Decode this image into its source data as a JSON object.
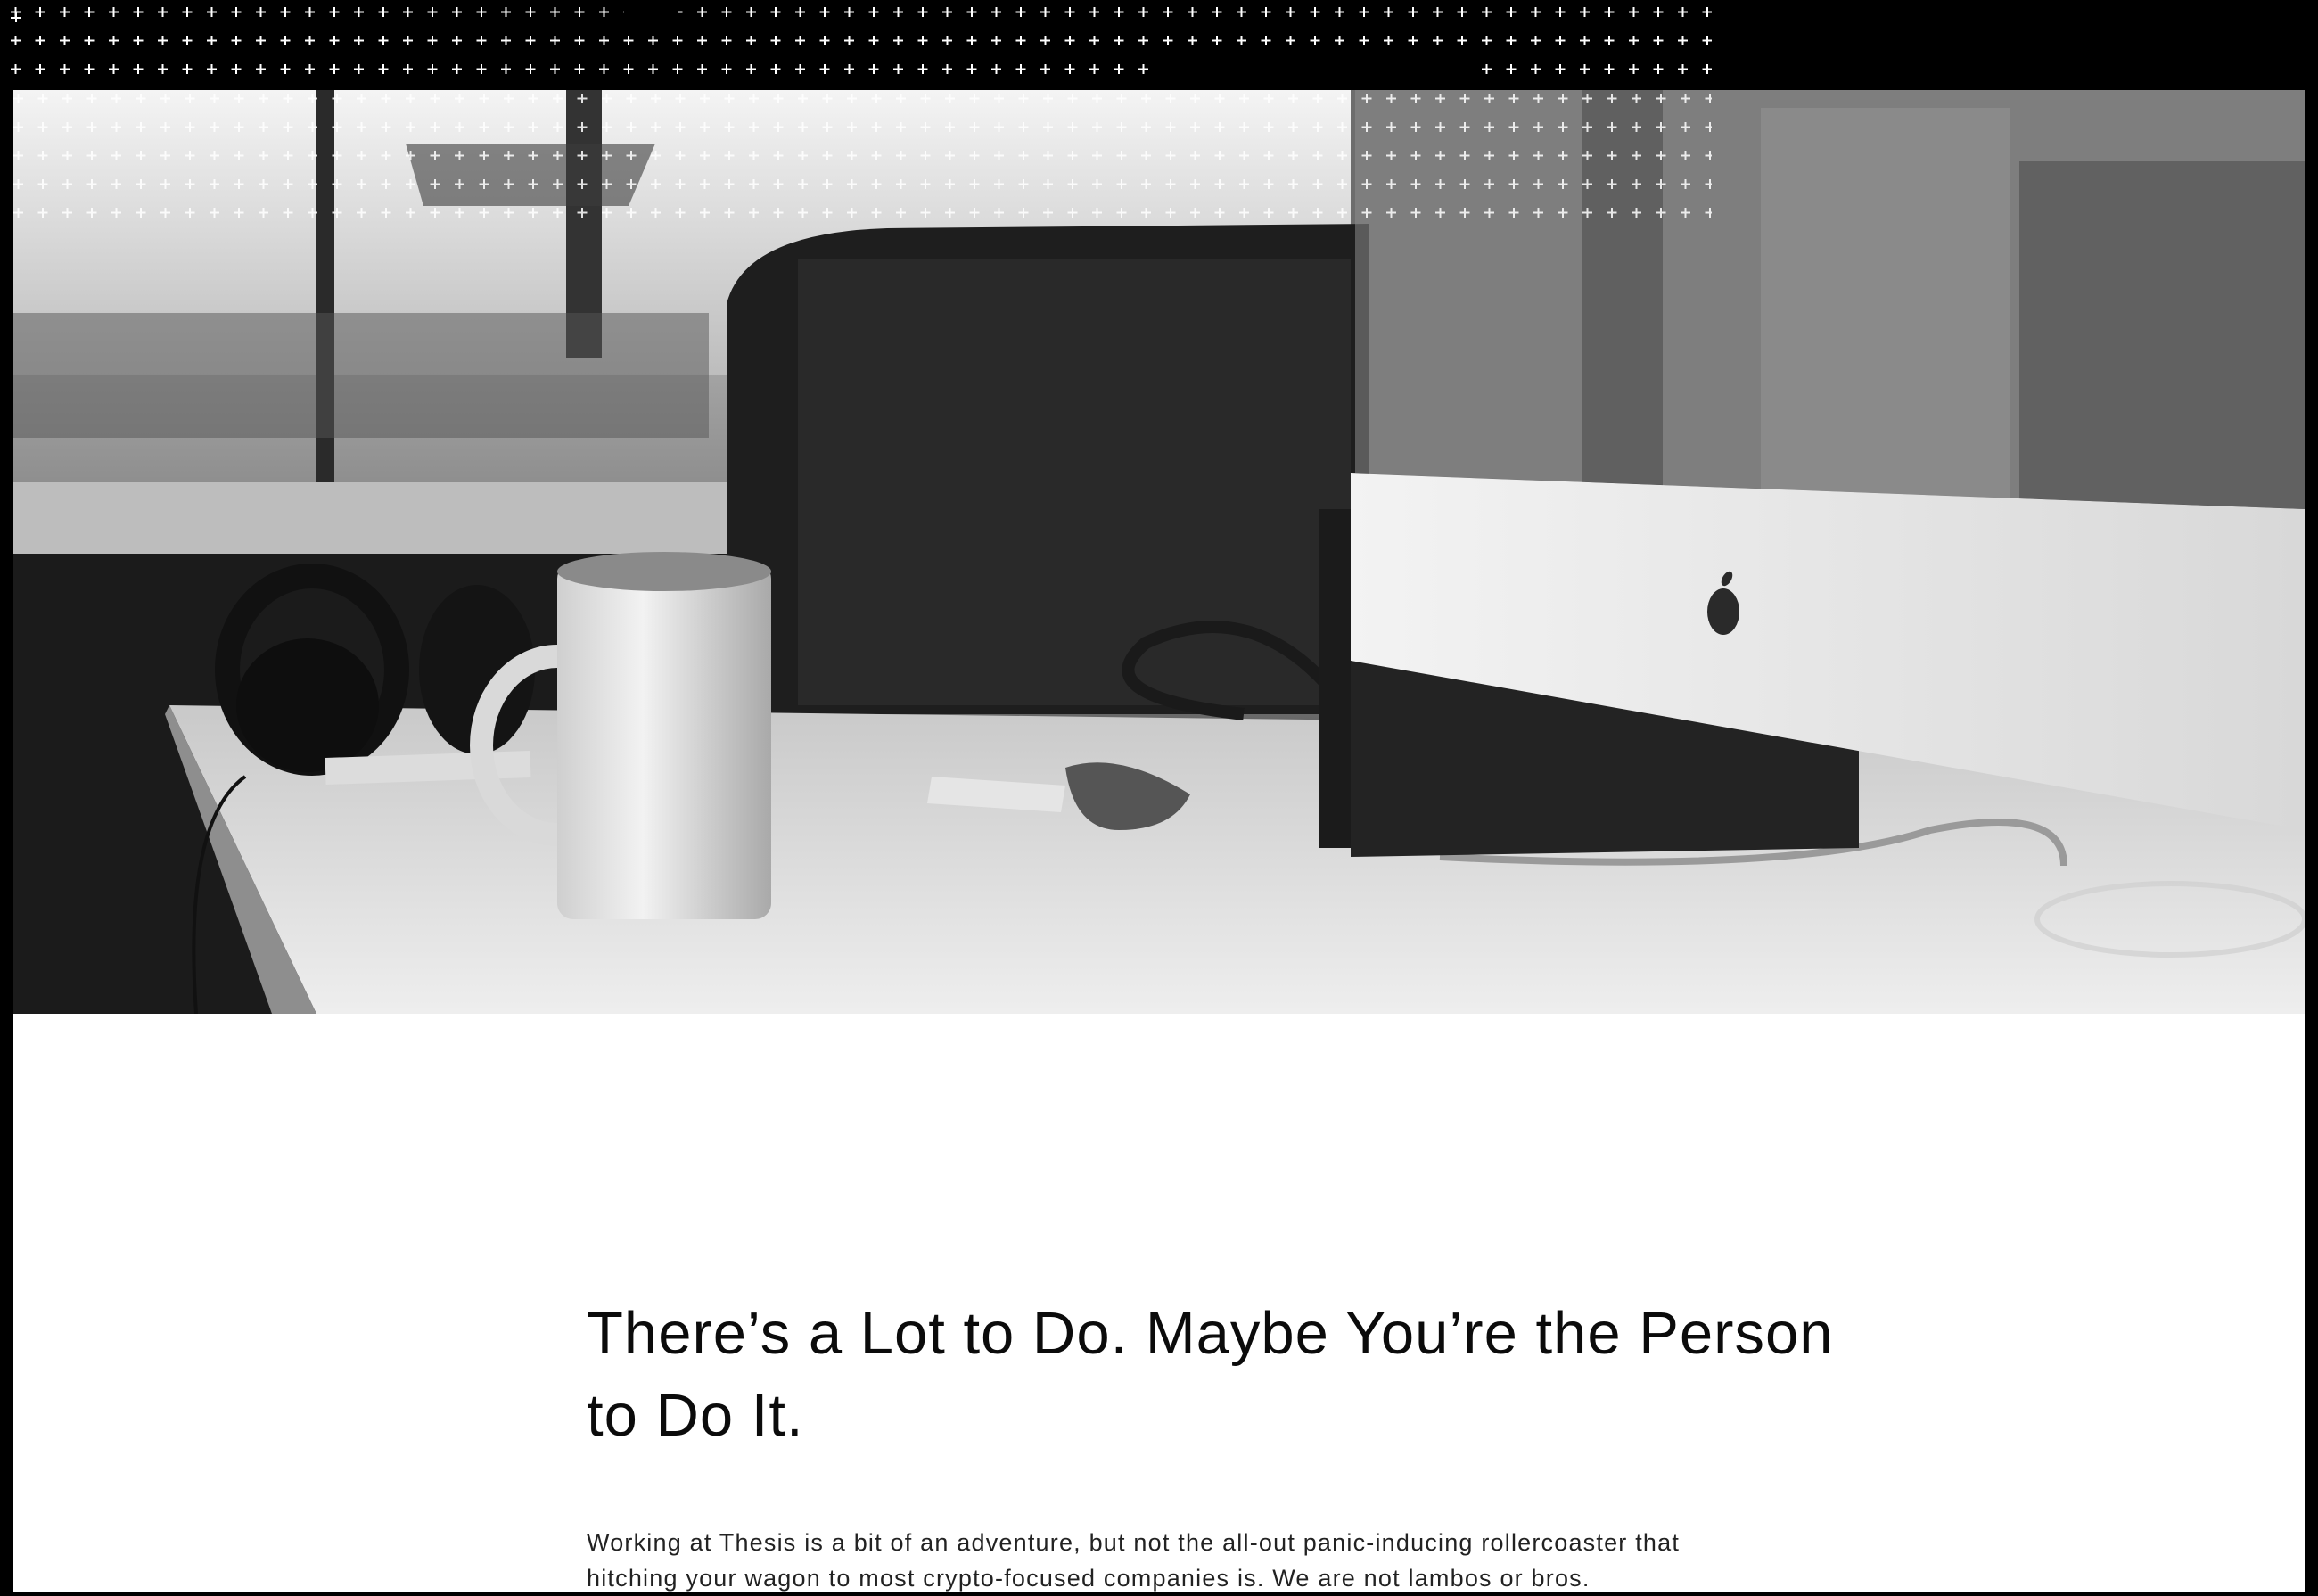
{
  "hero": {
    "image_name": "black-and-white desk with mug, headphones and computer"
  },
  "main": {
    "headline": "There’s a Lot to Do. Maybe You’re the Person to Do It.",
    "body": "Working at Thesis is a bit of an adventure, but not the all-out panic-inducing rollercoaster that hitching your wagon to most crypto-focused companies is. We are not lambos or bros."
  },
  "colors": {
    "background": "#000000",
    "content_bg": "#ffffff",
    "text": "#0b0b0b"
  }
}
